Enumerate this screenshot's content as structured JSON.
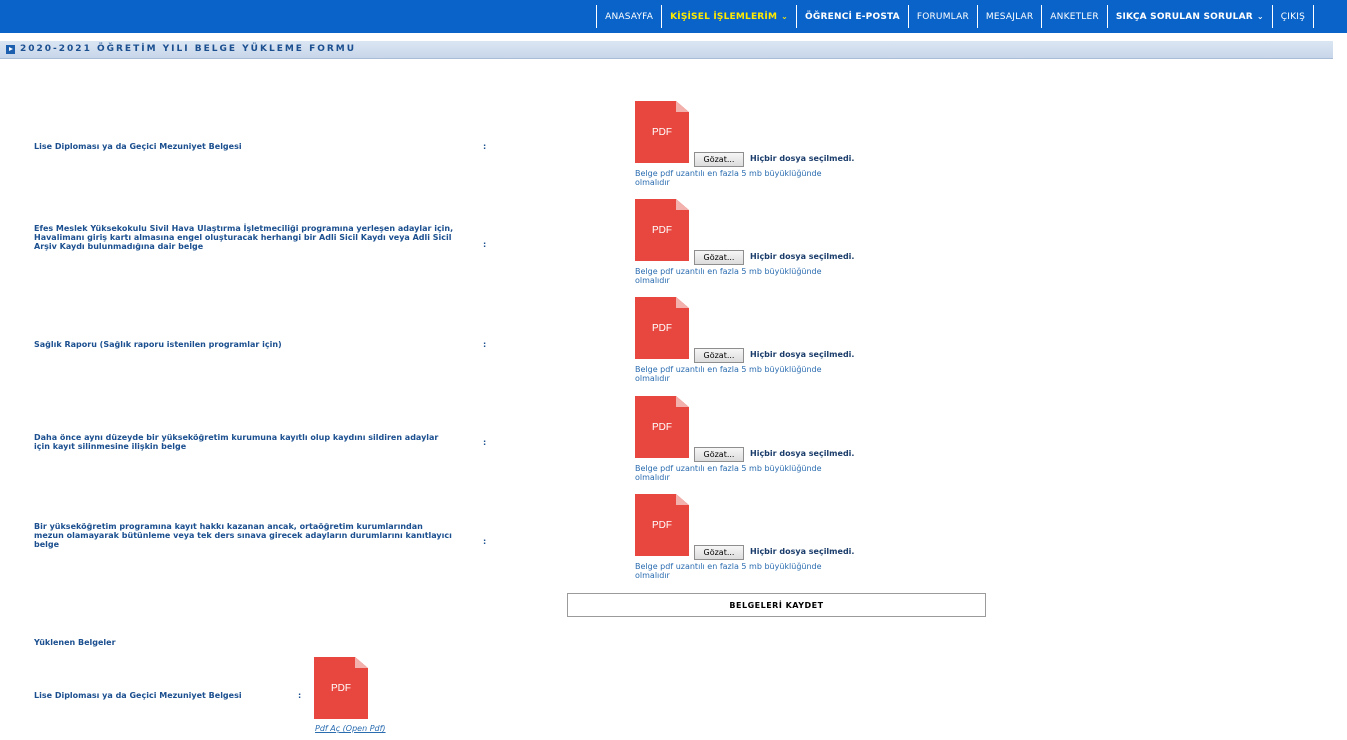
{
  "nav": {
    "items": [
      {
        "label": "ANASAYFA"
      },
      {
        "label": "KİŞİSEL İŞLEMLERİM"
      },
      {
        "label": "ÖĞRENCİ E-POSTA"
      },
      {
        "label": "FORUMLAR"
      },
      {
        "label": "MESAJLAR"
      },
      {
        "label": "ANKETLER"
      },
      {
        "label": "SIKÇA SORULAN SORULAR"
      },
      {
        "label": "ÇIKIŞ"
      }
    ],
    "chevron": "⌄"
  },
  "section": {
    "title": "2020-2021 ÖĞRETİM YILI BELGE YÜKLEME FORMU"
  },
  "colon": ":",
  "pdf_icon_text": "PDF",
  "browse_label": "Gözat...",
  "no_file_text": "Hiçbir dosya seçilmedi.",
  "hint_line1": "Belge pdf uzantılı en fazla 5 mb büyüklüğünde",
  "hint_line2": "olmalıdır",
  "rows": [
    {
      "label": "Lise Diploması ya da Geçici Mezuniyet Belgesi"
    },
    {
      "label": "Efes Meslek Yüksekokulu Sivil Hava Ulaştırma İşletmeciliği programına yerleşen adaylar için, Havalimanı giriş kartı almasına engel oluşturacak herhangi bir Adli Sicil Kaydı veya Adli Sicil Arşiv Kaydı bulunmadığına dair belge"
    },
    {
      "label": "Sağlık Raporu (Sağlık raporu istenilen programlar için)"
    },
    {
      "label": "Daha önce aynı düzeyde bir yükseköğretim kurumuna kayıtlı olup kaydını sildiren adaylar için kayıt silinmesine ilişkin belge"
    },
    {
      "label": "Bir yükseköğretim programına kayıt hakkı kazanan ancak, ortaöğretim kurumlarından mezun olamayarak bütünleme veya tek ders sınava girecek adayların durumlarını kanıtlayıcı belge"
    }
  ],
  "save_button": "BELGELERİ KAYDET",
  "uploaded": {
    "title": "Yüklenen Belgeler",
    "label": "Lise Diploması ya da Geçici Mezuniyet Belgesi",
    "link": "Pdf Aç (Open Pdf)"
  }
}
